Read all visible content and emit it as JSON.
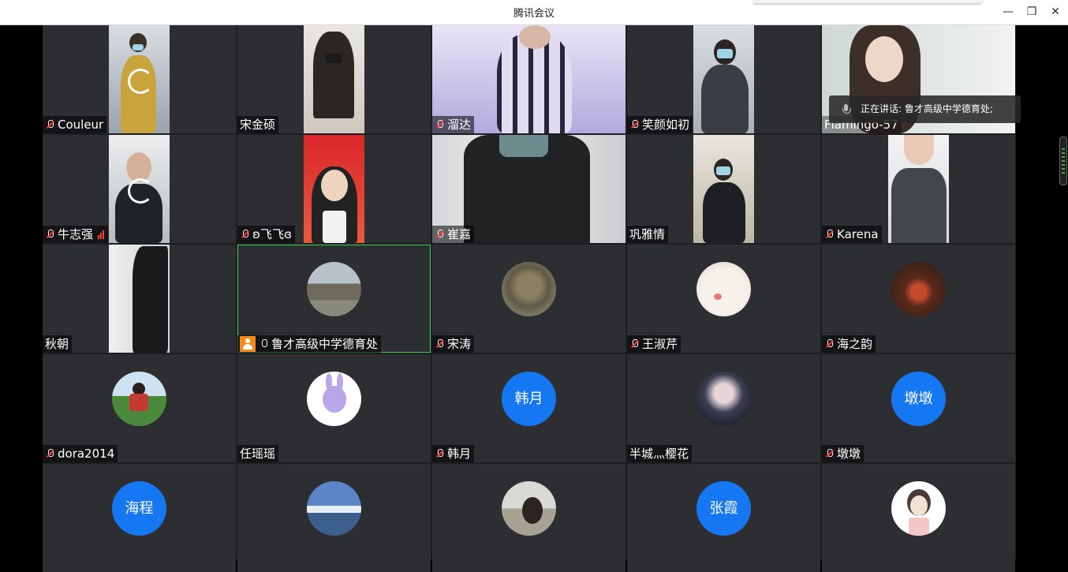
{
  "window": {
    "title": "腾讯会议",
    "minimize": "—",
    "restore": "❐",
    "close": "✕"
  },
  "speaking": {
    "text": "正在讲话: 鲁才高级中学德育处;"
  },
  "tiles": {
    "r1c1": {
      "name": "Couleur"
    },
    "r1c2": {
      "name": "宋金硕"
    },
    "r1c3": {
      "name": "溜达"
    },
    "r1c4": {
      "name": "笑颜如初"
    },
    "r1c5": {
      "name": "Flamingo-57"
    },
    "r2c1": {
      "name": "牛志强"
    },
    "r2c2": {
      "name": "ʚ飞飞ɞ"
    },
    "r2c3": {
      "name": "崔嘉"
    },
    "r2c4": {
      "name": "巩雅情"
    },
    "r2c5": {
      "name": "Karena"
    },
    "r3c1": {
      "name": "秋朝"
    },
    "r3c2": {
      "name": "鲁才高级中学德育处"
    },
    "r3c3": {
      "name": "宋涛"
    },
    "r3c4": {
      "name": "王淑芹"
    },
    "r3c5": {
      "name": "海之韵"
    },
    "r4c1": {
      "name": "dora2014"
    },
    "r4c2": {
      "name": "任瑶瑶"
    },
    "r4c3": {
      "name": "韩月",
      "avatar_text": "韩月"
    },
    "r4c4": {
      "name": "半城灬樱花"
    },
    "r4c5": {
      "name": "墩墩",
      "avatar_text": "墩墩"
    },
    "r5c1": {
      "avatar_text": "海程"
    },
    "r5c4": {
      "avatar_text": "张霞"
    }
  },
  "colors": {
    "accent": "#1677f2",
    "host": "#f28a1d",
    "active_border": "#3fcf5a",
    "muted": "#ff3b30"
  }
}
